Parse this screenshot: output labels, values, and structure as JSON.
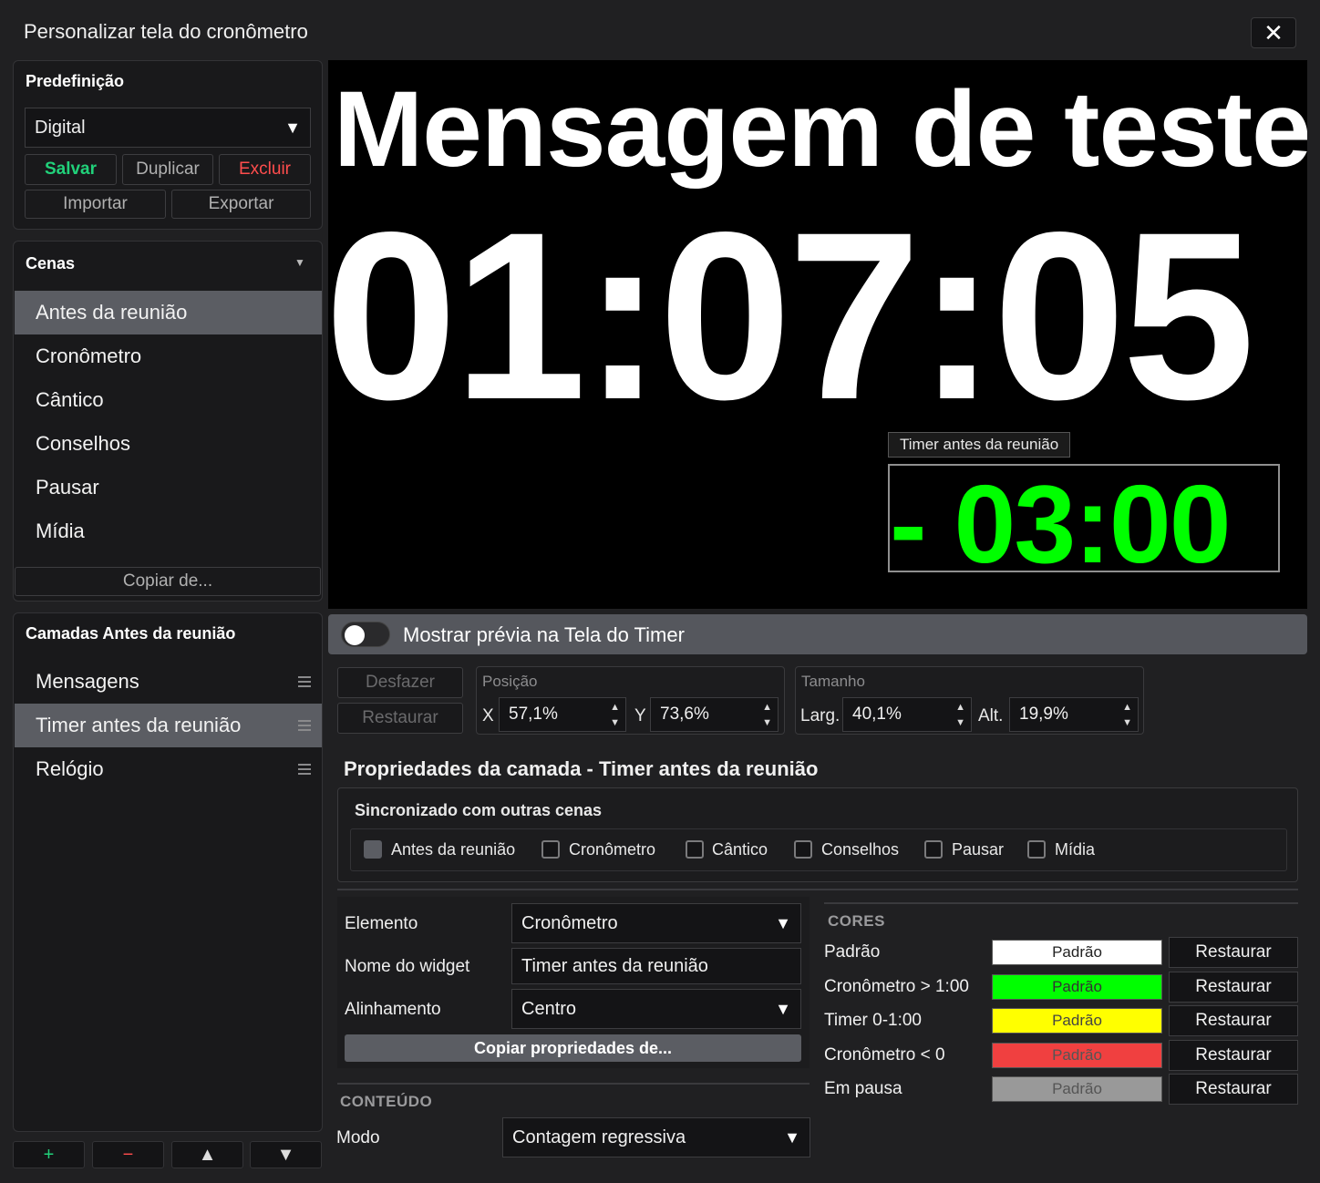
{
  "window": {
    "title": "Personalizar tela do cronômetro"
  },
  "preset": {
    "heading": "Predefinição",
    "selected": "Digital",
    "save": "Salvar",
    "duplicate": "Duplicar",
    "delete": "Excluir",
    "import": "Importar",
    "export": "Exportar"
  },
  "scenes": {
    "heading": "Cenas",
    "items": [
      "Antes da reunião",
      "Cronômetro",
      "Cântico",
      "Conselhos",
      "Pausar",
      "Mídia"
    ],
    "selected": "Antes da reunião",
    "copy_from": "Copiar de..."
  },
  "layers": {
    "heading": "Camadas Antes da reunião",
    "items": [
      "Mensagens",
      "Timer antes da reunião",
      "Relógio"
    ],
    "selected": "Timer antes da reunião"
  },
  "bottom_buttons": {
    "add": "+",
    "remove": "−",
    "up": "▲",
    "down": "▼"
  },
  "preview": {
    "message": "Mensagem de teste",
    "clock": "01:07:05",
    "timer_tag": "Timer antes da reunião",
    "timer_value": "- 03:00"
  },
  "toggle": {
    "label": "Mostrar prévia na Tela do Timer",
    "on": false
  },
  "edit": {
    "undo": "Desfazer",
    "restore": "Restaurar"
  },
  "position": {
    "label": "Posição",
    "x_label": "X",
    "x": "57,1%",
    "y_label": "Y",
    "y": "73,6%"
  },
  "size": {
    "label": "Tamanho",
    "w_label": "Larg.",
    "w": "40,1%",
    "h_label": "Alt.",
    "h": "19,9%"
  },
  "layer_props": {
    "title": "Propriedades da camada - Timer antes da reunião",
    "sync_heading": "Sincronizado com outras cenas",
    "sync_items": [
      {
        "label": "Antes da reunião",
        "checked": true
      },
      {
        "label": "Cronômetro",
        "checked": false
      },
      {
        "label": "Cântico",
        "checked": false
      },
      {
        "label": "Conselhos",
        "checked": false
      },
      {
        "label": "Pausar",
        "checked": false
      },
      {
        "label": "Mídia",
        "checked": false
      }
    ]
  },
  "form": {
    "element_label": "Elemento",
    "element_value": "Cronômetro",
    "widget_name_label": "Nome do widget",
    "widget_name_value": "Timer antes da reunião",
    "align_label": "Alinhamento",
    "align_value": "Centro",
    "copy_props": "Copiar propriedades de..."
  },
  "content": {
    "heading": "CONTEÚDO",
    "mode_label": "Modo",
    "mode_value": "Contagem regressiva"
  },
  "colors": {
    "heading": "CORES",
    "rows": [
      {
        "label": "Padrão",
        "swatch": "Padrão",
        "color": "#ffffff",
        "text": "#222222",
        "restore": "Restaurar"
      },
      {
        "label": "Cronômetro > 1:00",
        "swatch": "Padrão",
        "color": "#00ff00",
        "text": "#333333",
        "restore": "Restaurar"
      },
      {
        "label": "Timer 0-1:00",
        "swatch": "Padrão",
        "color": "#ffff00",
        "text": "#444444",
        "restore": "Restaurar"
      },
      {
        "label": "Cronômetro < 0",
        "swatch": "Padrão",
        "color": "#f04040",
        "text": "#555555",
        "restore": "Restaurar"
      },
      {
        "label": "Em pausa",
        "swatch": "Padrão",
        "color": "#999999",
        "text": "#555555",
        "restore": "Restaurar"
      }
    ]
  },
  "accent_colors": {
    "save": "#21d17a",
    "delete": "#ff4d4d",
    "timer": "#00ff00",
    "selection": "#5b5d63"
  }
}
